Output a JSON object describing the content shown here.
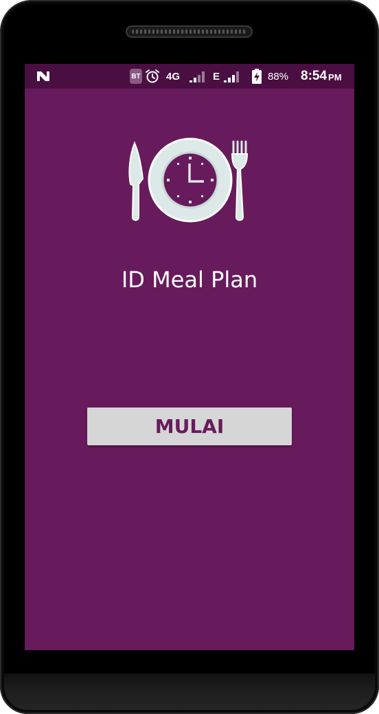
{
  "status_bar": {
    "notification_icon": "n-logo-icon",
    "bt_badge": "BT",
    "alarm_icon": "alarm-clock-icon",
    "network_4g": "4G",
    "network_e": "E",
    "battery_icon": "battery-charging-icon",
    "battery_percent": "88%",
    "time": "8:54",
    "ampm": "PM"
  },
  "app": {
    "logo_icon": "plate-clock-cutlery-icon",
    "title": "ID Meal Plan",
    "start_button_label": "MULAI"
  },
  "colors": {
    "background": "#671b5c",
    "status_bar": "#4a0f42",
    "button": "#d6d6d6",
    "button_text": "#671b5c",
    "logo": "#dde8e8"
  }
}
